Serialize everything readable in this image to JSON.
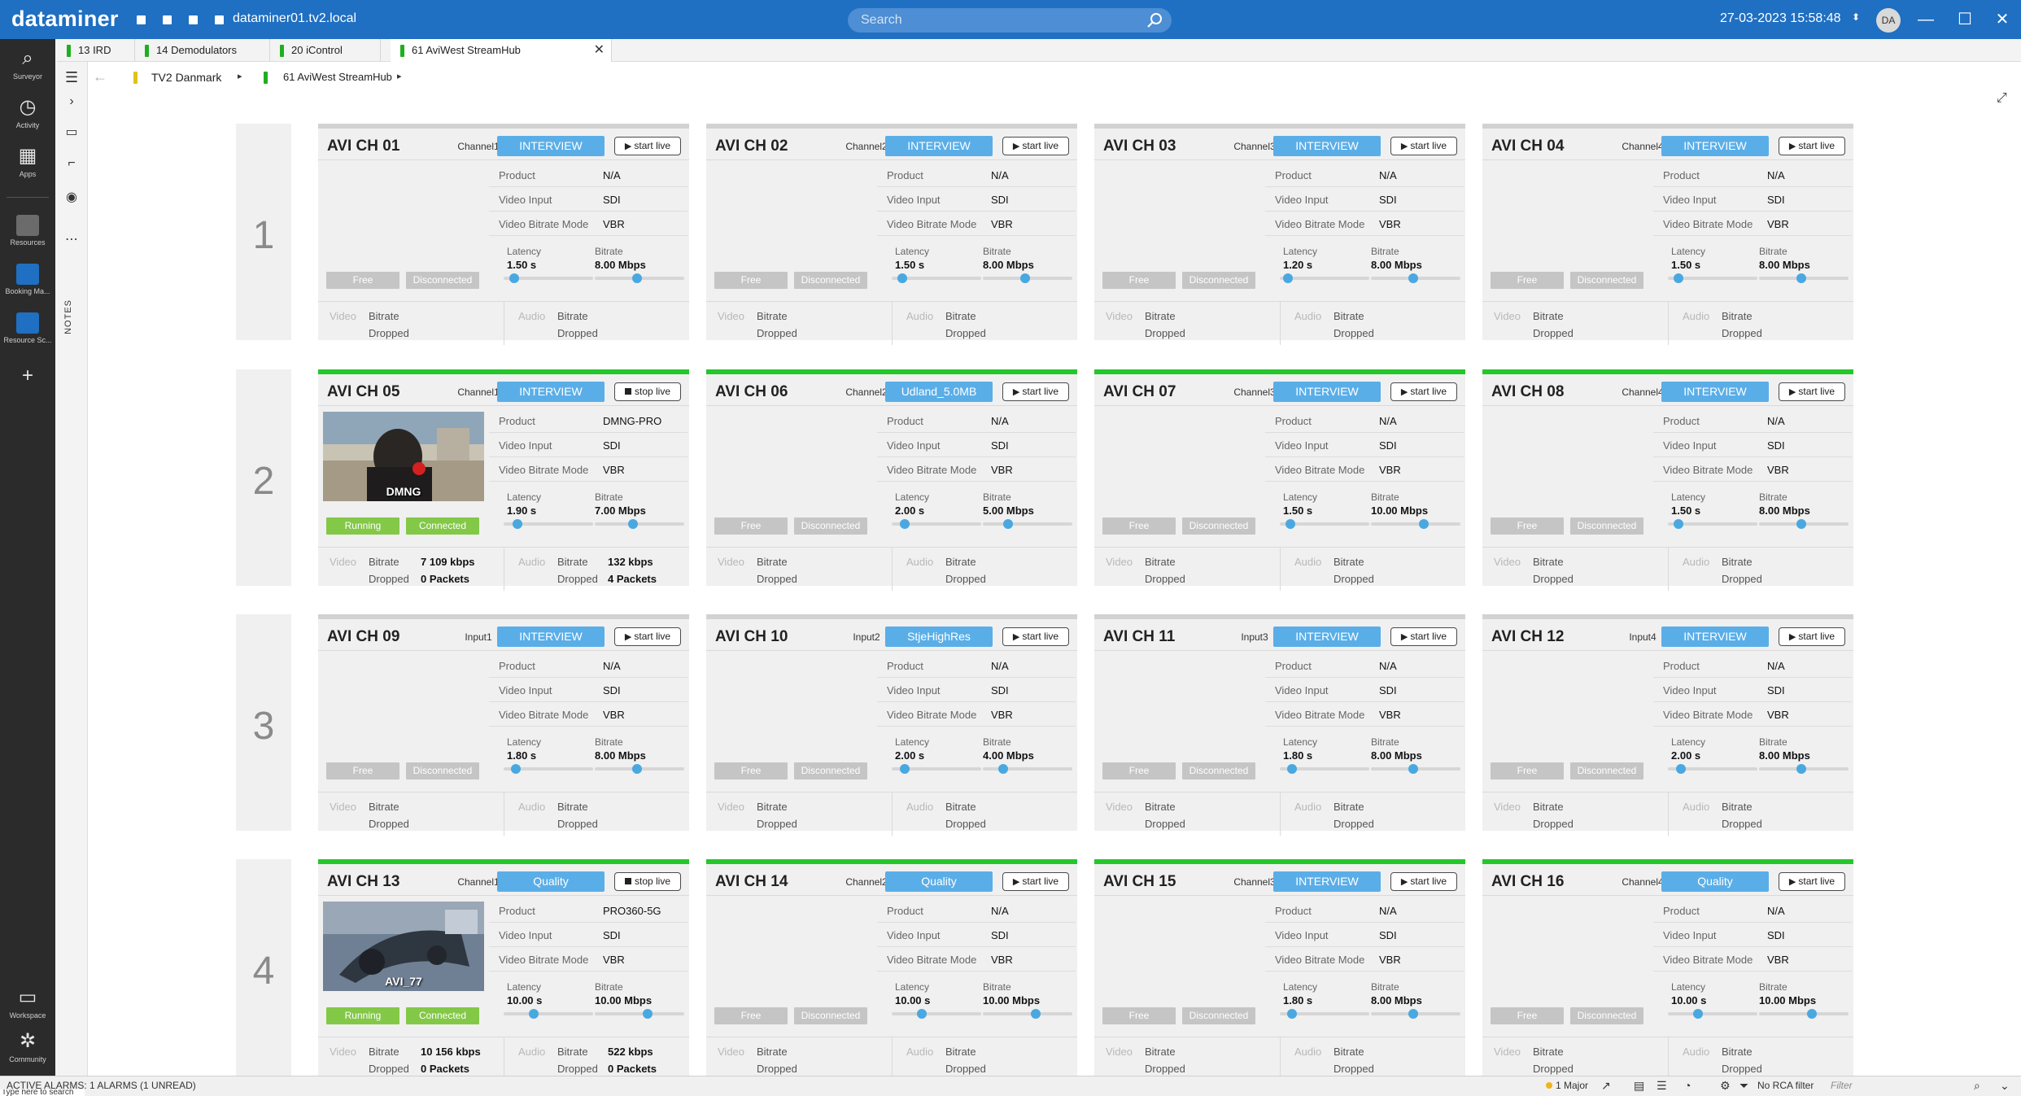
{
  "app": {
    "logo": "dataminer",
    "hostname": "dataminer01.tv2.local",
    "datetime": "27-03-2023 15:58:48",
    "user_initials": "DA"
  },
  "search": {
    "placeholder": "Search"
  },
  "sidebar": {
    "items": [
      {
        "label": "Surveyor",
        "icon": "surveyor-icon"
      },
      {
        "label": "Activity",
        "icon": "activity-icon"
      },
      {
        "label": "Apps",
        "icon": "apps-icon"
      },
      {
        "label": "Resources",
        "icon": "resources-icon"
      },
      {
        "label": "Booking Ma...",
        "icon": "booking-icon"
      },
      {
        "label": "Resource Sc...",
        "icon": "resource-scheduler-icon"
      },
      {
        "label": "Workspace",
        "icon": "workspace-icon"
      },
      {
        "label": "Community",
        "icon": "community-icon"
      }
    ]
  },
  "rail": {
    "notes_label": "NOTES"
  },
  "tabs": [
    {
      "label": "13 IRD",
      "active": false
    },
    {
      "label": "14 Demodulators",
      "active": false
    },
    {
      "label": "20 iControl",
      "active": false
    },
    {
      "label": "61 AviWest StreamHub",
      "active": true
    }
  ],
  "breadcrumb": {
    "items": [
      {
        "label": "TV2 Danmark",
        "color": "#e0c21a"
      },
      {
        "label": "61 AviWest StreamHub",
        "color": "#1fae1f"
      }
    ]
  },
  "labels": {
    "product": "Product",
    "video_input": "Video Input",
    "video_bitrate_mode": "Video Bitrate Mode",
    "latency": "Latency",
    "bitrate": "Bitrate",
    "video": "Video",
    "audio": "Audio",
    "dropped": "Dropped"
  },
  "rows": [
    "1",
    "2",
    "3",
    "4"
  ],
  "channels": [
    {
      "name": "AVI CH 01",
      "channel": "Channel1",
      "mode": "INTERVIEW",
      "live": "start live",
      "product": "N/A",
      "video_input": "SDI",
      "bitrate_mode": "VBR",
      "latency": "1.50 s",
      "latency_level": 0.07,
      "bitrate": "8.00 Mbps",
      "bitrate_level": 0.43,
      "state": "Free",
      "connection": "Disconnected",
      "active": false,
      "thumb": "",
      "v_bitrate": "",
      "v_dropped": "",
      "a_bitrate": "",
      "a_dropped": ""
    },
    {
      "name": "AVI CH 02",
      "channel": "Channel2",
      "mode": "INTERVIEW",
      "live": "start live",
      "product": "N/A",
      "video_input": "SDI",
      "bitrate_mode": "VBR",
      "latency": "1.50 s",
      "latency_level": 0.07,
      "bitrate": "8.00 Mbps",
      "bitrate_level": 0.43,
      "state": "Free",
      "connection": "Disconnected",
      "active": false,
      "thumb": "",
      "v_bitrate": "",
      "v_dropped": "",
      "a_bitrate": "",
      "a_dropped": ""
    },
    {
      "name": "AVI CH 03",
      "channel": "Channel3",
      "mode": "INTERVIEW",
      "live": "start live",
      "product": "N/A",
      "video_input": "SDI",
      "bitrate_mode": "VBR",
      "latency": "1.20 s",
      "latency_level": 0.04,
      "bitrate": "8.00 Mbps",
      "bitrate_level": 0.43,
      "state": "Free",
      "connection": "Disconnected",
      "active": false,
      "thumb": "",
      "v_bitrate": "",
      "v_dropped": "",
      "a_bitrate": "",
      "a_dropped": ""
    },
    {
      "name": "AVI CH 04",
      "channel": "Channel4",
      "mode": "INTERVIEW",
      "live": "start live",
      "product": "N/A",
      "video_input": "SDI",
      "bitrate_mode": "VBR",
      "latency": "1.50 s",
      "latency_level": 0.07,
      "bitrate": "8.00 Mbps",
      "bitrate_level": 0.43,
      "state": "Free",
      "connection": "Disconnected",
      "active": false,
      "thumb": "",
      "v_bitrate": "",
      "v_dropped": "",
      "a_bitrate": "",
      "a_dropped": ""
    },
    {
      "name": "AVI CH 05",
      "channel": "Channel1",
      "mode": "INTERVIEW",
      "live": "stop live",
      "product": "DMNG-PRO",
      "video_input": "SDI",
      "bitrate_mode": "VBR",
      "latency": "1.90 s",
      "latency_level": 0.11,
      "bitrate": "7.00 Mbps",
      "bitrate_level": 0.38,
      "state": "Running",
      "connection": "Connected",
      "active": true,
      "thumb": "DMNG",
      "v_bitrate": "7 109 kbps",
      "v_dropped": "0 Packets",
      "a_bitrate": "132 kbps",
      "a_dropped": "4 Packets"
    },
    {
      "name": "AVI CH 06",
      "channel": "Channel2",
      "mode": "Udland_5.0MB",
      "live": "start live",
      "product": "N/A",
      "video_input": "SDI",
      "bitrate_mode": "VBR",
      "latency": "2.00 s",
      "latency_level": 0.1,
      "bitrate": "5.00 Mbps",
      "bitrate_level": 0.23,
      "state": "Free",
      "connection": "Disconnected",
      "active": true,
      "thumb": "",
      "v_bitrate": "",
      "v_dropped": "",
      "a_bitrate": "",
      "a_dropped": ""
    },
    {
      "name": "AVI CH 07",
      "channel": "Channel3",
      "mode": "INTERVIEW",
      "live": "start live",
      "product": "N/A",
      "video_input": "SDI",
      "bitrate_mode": "VBR",
      "latency": "1.50 s",
      "latency_level": 0.07,
      "bitrate": "10.00 Mbps",
      "bitrate_level": 0.55,
      "state": "Free",
      "connection": "Disconnected",
      "active": true,
      "thumb": "",
      "v_bitrate": "",
      "v_dropped": "",
      "a_bitrate": "",
      "a_dropped": ""
    },
    {
      "name": "AVI CH 08",
      "channel": "Channel4",
      "mode": "INTERVIEW",
      "live": "start live",
      "product": "N/A",
      "video_input": "SDI",
      "bitrate_mode": "VBR",
      "latency": "1.50 s",
      "latency_level": 0.07,
      "bitrate": "8.00 Mbps",
      "bitrate_level": 0.43,
      "state": "Free",
      "connection": "Disconnected",
      "active": true,
      "thumb": "",
      "v_bitrate": "",
      "v_dropped": "",
      "a_bitrate": "",
      "a_dropped": ""
    },
    {
      "name": "AVI CH 09",
      "channel": "Input1",
      "mode": "INTERVIEW",
      "live": "start live",
      "product": "N/A",
      "video_input": "SDI",
      "bitrate_mode": "VBR",
      "latency": "1.80 s",
      "latency_level": 0.09,
      "bitrate": "8.00 Mbps",
      "bitrate_level": 0.43,
      "state": "Free",
      "connection": "Disconnected",
      "active": false,
      "thumb": "",
      "v_bitrate": "",
      "v_dropped": "",
      "a_bitrate": "",
      "a_dropped": ""
    },
    {
      "name": "AVI CH 10",
      "channel": "Input2",
      "mode": "StjeHighRes",
      "live": "start live",
      "product": "N/A",
      "video_input": "SDI",
      "bitrate_mode": "VBR",
      "latency": "2.00 s",
      "latency_level": 0.1,
      "bitrate": "4.00 Mbps",
      "bitrate_level": 0.18,
      "state": "Free",
      "connection": "Disconnected",
      "active": false,
      "thumb": "",
      "v_bitrate": "",
      "v_dropped": "",
      "a_bitrate": "",
      "a_dropped": ""
    },
    {
      "name": "AVI CH 11",
      "channel": "Input3",
      "mode": "INTERVIEW",
      "live": "start live",
      "product": "N/A",
      "video_input": "SDI",
      "bitrate_mode": "VBR",
      "latency": "1.80 s",
      "latency_level": 0.09,
      "bitrate": "8.00 Mbps",
      "bitrate_level": 0.43,
      "state": "Free",
      "connection": "Disconnected",
      "active": false,
      "thumb": "",
      "v_bitrate": "",
      "v_dropped": "",
      "a_bitrate": "",
      "a_dropped": ""
    },
    {
      "name": "AVI CH 12",
      "channel": "Input4",
      "mode": "INTERVIEW",
      "live": "start live",
      "product": "N/A",
      "video_input": "SDI",
      "bitrate_mode": "VBR",
      "latency": "2.00 s",
      "latency_level": 0.1,
      "bitrate": "8.00 Mbps",
      "bitrate_level": 0.43,
      "state": "Free",
      "connection": "Disconnected",
      "active": false,
      "thumb": "",
      "v_bitrate": "",
      "v_dropped": "",
      "a_bitrate": "",
      "a_dropped": ""
    },
    {
      "name": "AVI CH 13",
      "channel": "Channel1",
      "mode": "Quality",
      "live": "stop live",
      "product": "PRO360-5G",
      "video_input": "SDI",
      "bitrate_mode": "VBR",
      "latency": "10.00 s",
      "latency_level": 0.3,
      "bitrate": "10.00 Mbps",
      "bitrate_level": 0.55,
      "state": "Running",
      "connection": "Connected",
      "active": true,
      "thumb": "AVI_77",
      "v_bitrate": "10 156 kbps",
      "v_dropped": "0 Packets",
      "a_bitrate": "522 kbps",
      "a_dropped": "0 Packets"
    },
    {
      "name": "AVI CH 14",
      "channel": "Channel2",
      "mode": "Quality",
      "live": "start live",
      "product": "N/A",
      "video_input": "SDI",
      "bitrate_mode": "VBR",
      "latency": "10.00 s",
      "latency_level": 0.3,
      "bitrate": "10.00 Mbps",
      "bitrate_level": 0.55,
      "state": "Free",
      "connection": "Disconnected",
      "active": true,
      "thumb": "",
      "v_bitrate": "",
      "v_dropped": "",
      "a_bitrate": "",
      "a_dropped": ""
    },
    {
      "name": "AVI CH 15",
      "channel": "Channel3",
      "mode": "INTERVIEW",
      "live": "start live",
      "product": "N/A",
      "video_input": "SDI",
      "bitrate_mode": "VBR",
      "latency": "1.80 s",
      "latency_level": 0.09,
      "bitrate": "8.00 Mbps",
      "bitrate_level": 0.43,
      "state": "Free",
      "connection": "Disconnected",
      "active": true,
      "thumb": "",
      "v_bitrate": "",
      "v_dropped": "",
      "a_bitrate": "",
      "a_dropped": ""
    },
    {
      "name": "AVI CH 16",
      "channel": "Channel4",
      "mode": "Quality",
      "live": "start live",
      "product": "N/A",
      "video_input": "SDI",
      "bitrate_mode": "VBR",
      "latency": "10.00 s",
      "latency_level": 0.3,
      "bitrate": "10.00 Mbps",
      "bitrate_level": 0.55,
      "state": "Free",
      "connection": "Disconnected",
      "active": true,
      "thumb": "",
      "v_bitrate": "",
      "v_dropped": "",
      "a_bitrate": "",
      "a_dropped": ""
    }
  ],
  "statusbar": {
    "alarms": "ACTIVE ALARMS: 1 ALARMS (1 UNREAD)",
    "major": "1 Major",
    "rca": "No RCA filter",
    "filter_placeholder": "Filter",
    "taskbar": "Type here to search"
  }
}
